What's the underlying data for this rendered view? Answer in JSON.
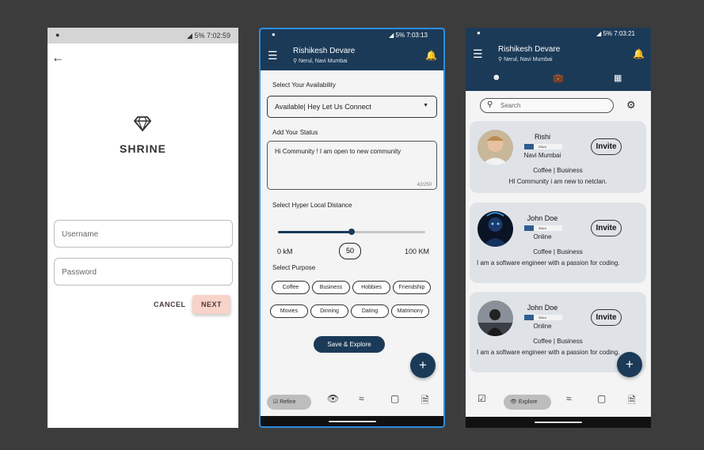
{
  "colors": {
    "primary": "#1b3a58",
    "accent_pink": "#f8d3c8",
    "highlight_border": "#2c8de0"
  },
  "screen1": {
    "status": {
      "battery": "5%",
      "time": "7:02:59"
    },
    "brand": "SHRINE",
    "username_placeholder": "Username",
    "password_placeholder": "Password",
    "cancel": "CANCEL",
    "next": "NEXT"
  },
  "screen2": {
    "status": {
      "battery": "5%",
      "time": "7:03:13"
    },
    "user": {
      "name": "Rishikesh Devare",
      "location": "Nerul, Navi Mumbai"
    },
    "availability_label": "Select Your Availability",
    "availability_value": "Available| Hey Let Us Connect",
    "status_label": "Add Your Status",
    "status_text": "Hi Community ! I am open to new community",
    "status_count": "42/250",
    "distance_label": "Select Hyper Local Distance",
    "distance_min": "0 kM",
    "distance_max": "100 KM",
    "distance_value": "50",
    "distance_fraction": 0.5,
    "purpose_label": "Select Purpose",
    "purposes": [
      "Coffee",
      "Business",
      "Hobbies",
      "Friendship",
      "Movies",
      "Dinning",
      "Dating",
      "Matrimony"
    ],
    "save_label": "Save & Explore",
    "nav_refine": "Refine"
  },
  "screen3": {
    "status": {
      "battery": "5%",
      "time": "7:03:21"
    },
    "user": {
      "name": "Rishikesh Devare",
      "location": "Nerul, Navi Mumbai"
    },
    "search_placeholder": "Search",
    "nav_explore": "Explore",
    "cards": [
      {
        "name": "Rishi",
        "distance": "20km",
        "sub": "Navi Mumbai",
        "category": "Coffee | Business",
        "description": "HI Community i am new to netclan.",
        "invite": "Invite"
      },
      {
        "name": "John Doe",
        "distance": "30km",
        "sub": "Online",
        "category": "Coffee | Business",
        "description": "I am a software engineer with a passion for coding.",
        "invite": "Invite"
      },
      {
        "name": "John Doe",
        "distance": "30km",
        "sub": "Online",
        "category": "Coffee | Business",
        "description": "I am a software engineer with a passion for coding.",
        "invite": "Invite"
      }
    ]
  }
}
